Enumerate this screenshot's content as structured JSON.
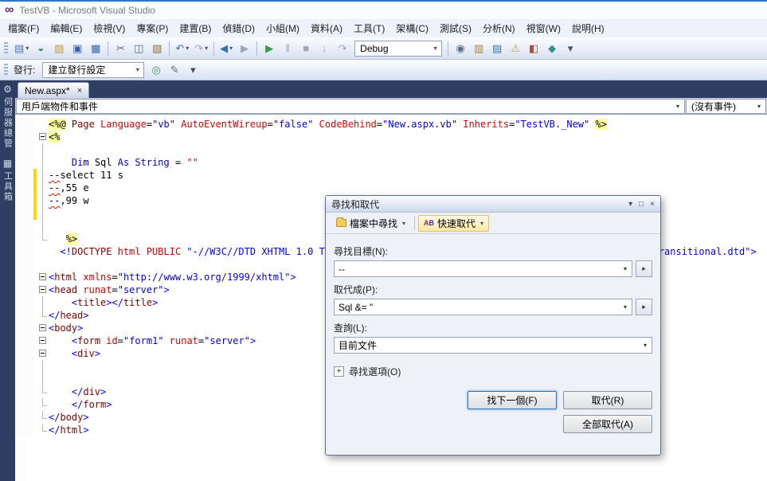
{
  "icons": {
    "logo": "∞",
    "caret": "▾",
    "close": "×",
    "float": "□",
    "menu": "▾",
    "expr": "▸",
    "plus": "+",
    "qr_a": "A",
    "qr_b": "B"
  },
  "window": {
    "title": "TestVB - Microsoft Visual Studio"
  },
  "menu": {
    "items": [
      "檔案(F)",
      "編輯(E)",
      "檢視(V)",
      "專案(P)",
      "建置(B)",
      "偵錯(D)",
      "小組(M)",
      "資料(A)",
      "工具(T)",
      "架構(C)",
      "測試(S)",
      "分析(N)",
      "視窗(W)",
      "說明(H)"
    ]
  },
  "toolbar_main": {
    "items": [
      {
        "type": "icon",
        "name": "new-project-icon",
        "glyph": "▤",
        "color": "#4f74b8",
        "caret": true
      },
      {
        "type": "icon",
        "name": "open-web-icon",
        "glyph": "◒",
        "color": "#2f8f5a"
      },
      {
        "type": "icon",
        "name": "open-file-icon",
        "glyph": "▨",
        "color": "#c9973a"
      },
      {
        "type": "icon",
        "name": "save-icon",
        "glyph": "▣",
        "color": "#3a5fae"
      },
      {
        "type": "icon",
        "name": "save-all-icon",
        "glyph": "▦",
        "color": "#3a5fae"
      },
      {
        "type": "sep"
      },
      {
        "type": "icon",
        "name": "cut-icon",
        "glyph": "✂",
        "color": "#5a6b85"
      },
      {
        "type": "icon",
        "name": "copy-icon",
        "glyph": "◫",
        "color": "#5a6b85"
      },
      {
        "type": "icon",
        "name": "paste-icon",
        "glyph": "▧",
        "color": "#8a6d3b"
      },
      {
        "type": "sep"
      },
      {
        "type": "icon",
        "name": "undo-icon",
        "glyph": "↶",
        "color": "#3a6fb0",
        "caret": true
      },
      {
        "type": "icon",
        "name": "redo-icon",
        "glyph": "↷",
        "color": "#9aa7bd",
        "caret": true
      },
      {
        "type": "sep"
      },
      {
        "type": "icon",
        "name": "navigate-back-icon",
        "glyph": "◀",
        "color": "#3a6fb0",
        "caret": true
      },
      {
        "type": "icon",
        "name": "navigate-forward-icon",
        "glyph": "▶",
        "color": "#9aa7bd"
      },
      {
        "type": "sep"
      },
      {
        "type": "icon",
        "name": "start-debug-icon",
        "glyph": "▶",
        "color": "#2f9e44"
      },
      {
        "type": "icon",
        "name": "break-all-icon",
        "glyph": "‖",
        "color": "#9aa7bd"
      },
      {
        "type": "icon",
        "name": "stop-debug-icon",
        "glyph": "■",
        "color": "#9aa7bd"
      },
      {
        "type": "icon",
        "name": "step-into-icon",
        "glyph": "↓",
        "color": "#9aa7bd"
      },
      {
        "type": "icon",
        "name": "step-over-icon",
        "glyph": "↷",
        "color": "#9aa7bd"
      },
      {
        "type": "combo",
        "name": "debug-target-combo",
        "value": "Debug",
        "width": 110
      },
      {
        "type": "sep"
      },
      {
        "type": "icon",
        "name": "find-in-files-toolbar-icon",
        "glyph": "◉",
        "color": "#5a6b85"
      },
      {
        "type": "icon",
        "name": "solution-explorer-icon",
        "glyph": "▥",
        "color": "#b08030"
      },
      {
        "type": "icon",
        "name": "properties-window-icon",
        "glyph": "▤",
        "color": "#3a6fb0"
      },
      {
        "type": "icon",
        "name": "error-list-icon",
        "glyph": "⚠",
        "color": "#c9a23a"
      },
      {
        "type": "icon",
        "name": "toolbox-tool-icon",
        "glyph": "◧",
        "color": "#b04a3a"
      },
      {
        "type": "icon",
        "name": "extensions-icon",
        "glyph": "◆",
        "color": "#3a8f8f"
      },
      {
        "type": "icon",
        "name": "toolbar-overflow-icon",
        "glyph": "▾",
        "color": "#44506b"
      }
    ]
  },
  "toolbar_publish": {
    "items": [
      {
        "type": "label",
        "name": "publish-label",
        "text": "發行:"
      },
      {
        "type": "combo",
        "name": "publish-profile-combo",
        "value": "建立發行設定",
        "width": 128
      },
      {
        "type": "icon",
        "name": "publish-icon",
        "glyph": "◎",
        "color": "#3a8f5a"
      },
      {
        "type": "icon",
        "name": "publish-settings-icon",
        "glyph": "✎",
        "color": "#5a6b85"
      },
      {
        "type": "icon",
        "name": "publish-overflow-icon",
        "glyph": "▾",
        "color": "#44506b"
      }
    ]
  },
  "tabs": [
    {
      "label": "New.aspx*"
    }
  ],
  "navbar": {
    "left_value": "用戶端物件和事件",
    "right_value": "(沒有事件)"
  },
  "sidebar": {
    "tabs": [
      {
        "name": "server-explorer",
        "icon": "⚙",
        "label": "伺服器總管"
      },
      {
        "name": "toolbox",
        "icon": "▦",
        "label": "工具箱"
      }
    ]
  },
  "editor": {
    "lines": [
      {
        "out": "none",
        "chg": false,
        "seg": [
          [
            "srv",
            "<%@"
          ],
          [
            "p",
            " "
          ],
          [
            "e",
            "Page"
          ],
          [
            "p",
            " "
          ],
          [
            "a",
            "Language"
          ],
          [
            "p",
            "="
          ],
          [
            "v",
            "\"vb\""
          ],
          [
            "p",
            " "
          ],
          [
            "a",
            "AutoEventWireup"
          ],
          [
            "p",
            "="
          ],
          [
            "v",
            "\"false\""
          ],
          [
            "p",
            " "
          ],
          [
            "a",
            "CodeBehind"
          ],
          [
            "p",
            "="
          ],
          [
            "v",
            "\"New.aspx.vb\""
          ],
          [
            "p",
            " "
          ],
          [
            "a",
            "Inherits"
          ],
          [
            "p",
            "="
          ],
          [
            "v",
            "\"TestVB._New\""
          ],
          [
            "p",
            " "
          ],
          [
            "srv",
            "%>"
          ]
        ]
      },
      {
        "out": "box",
        "chg": false,
        "seg": [
          [
            "srv",
            "<%"
          ]
        ]
      },
      {
        "out": "line",
        "chg": false,
        "seg": []
      },
      {
        "out": "line",
        "chg": false,
        "seg": [
          [
            "p",
            "    "
          ],
          [
            "k",
            "Dim"
          ],
          [
            "p",
            " Sql "
          ],
          [
            "k",
            "As"
          ],
          [
            "p",
            " "
          ],
          [
            "k",
            "String"
          ],
          [
            "p",
            " = "
          ],
          [
            "s",
            "\"\""
          ]
        ]
      },
      {
        "out": "line",
        "chg": true,
        "seg": [
          [
            "err",
            "--"
          ],
          [
            "p",
            "select 11 s"
          ]
        ]
      },
      {
        "out": "line",
        "chg": true,
        "seg": [
          [
            "err",
            "--"
          ],
          [
            "p",
            ",55 e"
          ]
        ]
      },
      {
        "out": "line",
        "chg": true,
        "seg": [
          [
            "err",
            "--"
          ],
          [
            "p",
            ",99 w"
          ]
        ]
      },
      {
        "out": "line",
        "chg": true,
        "seg": []
      },
      {
        "out": "line",
        "chg": false,
        "seg": []
      },
      {
        "out": "end",
        "chg": false,
        "seg": [
          [
            "p",
            "   "
          ],
          [
            "srv",
            "%>"
          ]
        ]
      },
      {
        "out": "none",
        "chg": false,
        "seg": [
          [
            "p",
            "  "
          ],
          [
            "d",
            "<!"
          ],
          [
            "e",
            "DOCTYPE"
          ],
          [
            "a",
            " html PUBLIC "
          ],
          [
            "v",
            "\"-//W3C//DTD XHTML 1.0 Transitional//EN\""
          ],
          [
            "p",
            " "
          ],
          [
            "v",
            "\"http://www.w3.org/TR/xhtml1/DTD/xhtml1-transitional.dtd\""
          ],
          [
            "d",
            ">"
          ]
        ]
      },
      {
        "out": "none",
        "chg": false,
        "seg": []
      },
      {
        "out": "box",
        "chg": false,
        "seg": [
          [
            "d",
            "<"
          ],
          [
            "e",
            "html"
          ],
          [
            "p",
            " "
          ],
          [
            "a",
            "xmlns"
          ],
          [
            "p",
            "="
          ],
          [
            "v",
            "\"http://www.w3.org/1999/xhtml\""
          ],
          [
            "d",
            ">"
          ]
        ]
      },
      {
        "out": "box",
        "chg": false,
        "seg": [
          [
            "d",
            "<"
          ],
          [
            "e",
            "head"
          ],
          [
            "p",
            " "
          ],
          [
            "a",
            "runat"
          ],
          [
            "p",
            "="
          ],
          [
            "v",
            "\"server\""
          ],
          [
            "d",
            ">"
          ]
        ]
      },
      {
        "out": "line",
        "chg": false,
        "seg": [
          [
            "p",
            "    "
          ],
          [
            "d",
            "<"
          ],
          [
            "e",
            "title"
          ],
          [
            "d",
            "></"
          ],
          [
            "e",
            "title"
          ],
          [
            "d",
            ">"
          ]
        ]
      },
      {
        "out": "end",
        "chg": false,
        "seg": [
          [
            "d",
            "</"
          ],
          [
            "e",
            "head"
          ],
          [
            "d",
            ">"
          ]
        ]
      },
      {
        "out": "box",
        "chg": false,
        "seg": [
          [
            "d",
            "<"
          ],
          [
            "e",
            "body"
          ],
          [
            "d",
            ">"
          ]
        ]
      },
      {
        "out": "box",
        "chg": false,
        "seg": [
          [
            "p",
            "    "
          ],
          [
            "d",
            "<"
          ],
          [
            "e",
            "form"
          ],
          [
            "p",
            " "
          ],
          [
            "a",
            "id"
          ],
          [
            "p",
            "="
          ],
          [
            "v",
            "\"form1\""
          ],
          [
            "p",
            " "
          ],
          [
            "a",
            "runat"
          ],
          [
            "p",
            "="
          ],
          [
            "v",
            "\"server\""
          ],
          [
            "d",
            ">"
          ]
        ]
      },
      {
        "out": "box",
        "chg": false,
        "seg": [
          [
            "p",
            "    "
          ],
          [
            "d",
            "<"
          ],
          [
            "e",
            "div"
          ],
          [
            "d",
            ">"
          ]
        ]
      },
      {
        "out": "line",
        "chg": false,
        "seg": []
      },
      {
        "out": "line",
        "chg": false,
        "seg": []
      },
      {
        "out": "end",
        "chg": false,
        "seg": [
          [
            "p",
            "    "
          ],
          [
            "d",
            "</"
          ],
          [
            "e",
            "div"
          ],
          [
            "d",
            ">"
          ]
        ]
      },
      {
        "out": "end",
        "chg": false,
        "seg": [
          [
            "p",
            "    "
          ],
          [
            "d",
            "</"
          ],
          [
            "e",
            "form"
          ],
          [
            "d",
            ">"
          ]
        ]
      },
      {
        "out": "end",
        "chg": false,
        "seg": [
          [
            "d",
            "</"
          ],
          [
            "e",
            "body"
          ],
          [
            "d",
            ">"
          ]
        ]
      },
      {
        "out": "end",
        "chg": false,
        "seg": [
          [
            "d",
            "</"
          ],
          [
            "e",
            "html"
          ],
          [
            "d",
            ">"
          ]
        ]
      }
    ]
  },
  "find_dialog": {
    "title": "尋找和取代",
    "toolbar": {
      "find_in_files": "檔案中尋找",
      "quick_replace": "快速取代"
    },
    "find_label": "尋找目標(N):",
    "find_value": "--",
    "replace_label": "取代成(P):",
    "replace_value": "Sql &= \"",
    "scope_label": "查詢(L):",
    "scope_value": "目前文件",
    "options_label": "尋找選項(O)",
    "buttons": {
      "find_next": "找下一個(F)",
      "replace": "取代(R)",
      "replace_all": "全部取代(A)"
    }
  }
}
